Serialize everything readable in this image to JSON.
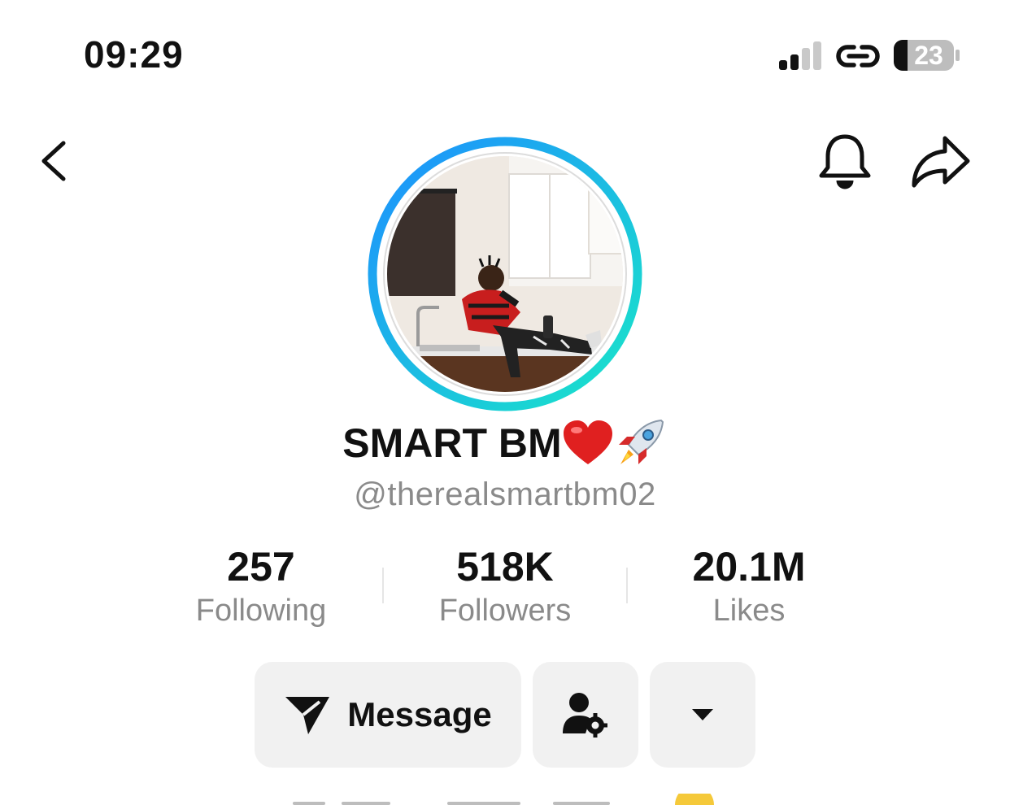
{
  "status_bar": {
    "time": "09:29",
    "battery_level": "23",
    "signal_icon": "cellular-signal-icon",
    "link_icon": "link-icon"
  },
  "nav": {
    "back_icon": "chevron-left-icon",
    "bell_icon": "bell-icon",
    "share_icon": "share-arrow-icon"
  },
  "profile": {
    "display_name": "SMART BM",
    "name_emojis": [
      "red-heart-emoji",
      "rocket-emoji"
    ],
    "handle": "@therealsmartbm02"
  },
  "stats": [
    {
      "value": "257",
      "label": "Following"
    },
    {
      "value": "518K",
      "label": "Followers"
    },
    {
      "value": "20.1M",
      "label": "Likes"
    }
  ],
  "actions": {
    "message_label": "Message",
    "message_icon": "send-paper-plane-icon",
    "friends_icon": "person-gear-icon",
    "more_icon": "caret-down-icon"
  },
  "colors": {
    "ring_start": "#1e8fff",
    "ring_end": "#19e6c8",
    "button_bg": "#f1f1f1",
    "secondary_text": "#8a8a8a"
  }
}
